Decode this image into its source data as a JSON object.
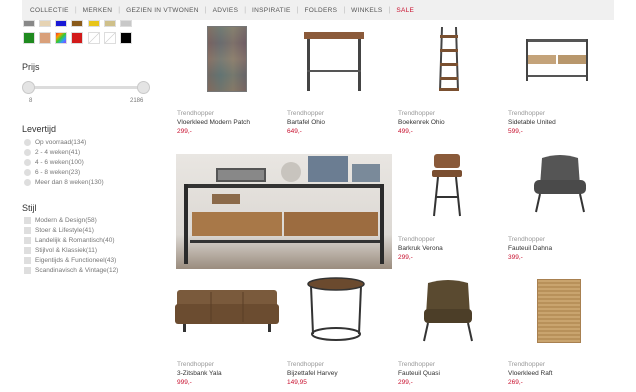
{
  "nav": {
    "items": [
      "COLLECTIE",
      "MERKEN",
      "GEZIEN IN VTWONEN",
      "ADVIES",
      "INSPIRATIE",
      "FOLDERS",
      "WINKELS",
      "SALE"
    ],
    "sale_color": "#c8102e"
  },
  "colors": {
    "row1": [
      "#888888",
      "#e6d3b3",
      "#1a1ad6",
      "#8a5a1a",
      "#e8c51a",
      "#cfc08a",
      "#c8c8c8"
    ],
    "row2": [
      "#1f8a1f",
      "#d9a07a",
      "multicolor",
      "#d21a1a",
      "#ffffff",
      "#ffffff",
      "#000000"
    ]
  },
  "filters": {
    "price": {
      "title": "Prijs",
      "min": "8",
      "max": "2186"
    },
    "delivery": {
      "title": "Levertijd",
      "options": [
        "Op voorraad(134)",
        "2 - 4 weken(41)",
        "4 - 6 weken(100)",
        "6 - 8 weken(23)",
        "Meer dan 8 weken(130)"
      ]
    },
    "style": {
      "title": "Stijl",
      "options": [
        "Modern & Design(58)",
        "Stoer & Lifestyle(41)",
        "Landelijk & Romantisch(40)",
        "Stijlvol & Klassiek(11)",
        "Eigentijds & Functioneel(43)",
        "Scandinavisch & Vintage(12)"
      ]
    }
  },
  "products": [
    {
      "brand": "Trendhopper",
      "name": "Vloerkleed Modern Patch",
      "price": "299,-",
      "icon": "rug-icon"
    },
    {
      "brand": "Trendhopper",
      "name": "Bartafel Ohio",
      "price": "649,-",
      "icon": "bar-table-icon"
    },
    {
      "brand": "Trendhopper",
      "name": "Boekenrek Ohio",
      "price": "499,-",
      "icon": "ladder-shelf-icon"
    },
    {
      "brand": "Trendhopper",
      "name": "Sidetable United",
      "price": "599,-",
      "icon": "sidetable-icon"
    },
    {
      "brand": "Trendhopper",
      "name": "Barkruk Verona",
      "price": "299,-",
      "icon": "bar-stool-icon"
    },
    {
      "brand": "Trendhopper",
      "name": "Fauteuil Dahna",
      "price": "399,-",
      "icon": "armchair-icon"
    },
    {
      "brand": "Trendhopper",
      "name": "3-Zitsbank Yala",
      "price": "999,-",
      "icon": "sofa-icon"
    },
    {
      "brand": "Trendhopper",
      "name": "Bijzettafel Harvey",
      "price": "149,95",
      "icon": "side-table-round-icon"
    },
    {
      "brand": "Trendhopper",
      "name": "Fauteuil Quasi",
      "price": "299,-",
      "icon": "leather-armchair-icon"
    },
    {
      "brand": "Trendhopper",
      "name": "Vloerkleed Raft",
      "price": "269,-",
      "icon": "jute-rug-icon"
    }
  ]
}
